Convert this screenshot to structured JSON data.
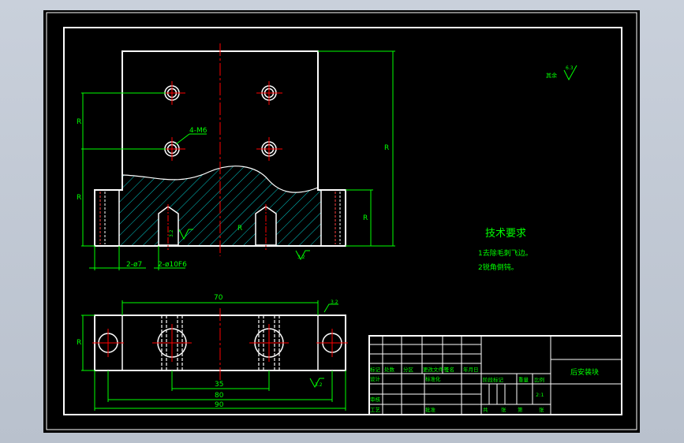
{
  "colors": {
    "background": "#000000",
    "outline": "#ffffff",
    "dimension": "#00ff00",
    "centerline": "#ff0000",
    "hatch": "#00c8c8",
    "annotation": "#00ff00"
  },
  "dims": {
    "a1": "R",
    "a2": "R",
    "a3": "R",
    "a4": "R",
    "a5": "R",
    "a6": "R",
    "thread": "4-M6",
    "hole7": "2-ø7",
    "fit": "2-ø10F6",
    "d70": "70",
    "d35": "35",
    "d80": "80",
    "d90": "90"
  },
  "surface": {
    "roughness_label": "其余",
    "rough1": "6.3",
    "rough2": "3.2",
    "rough3": "3.2",
    "rough4": "3.2"
  },
  "tech": {
    "title": "技术要求",
    "line1": "1去除毛刺飞边。",
    "line2": "2锐角倒钝。"
  },
  "titleblock": {
    "part_name": "后安装块",
    "marker": "标记",
    "count": "处数",
    "zone": "分区",
    "change_doc": "更改文件号",
    "sign": "签名",
    "date": "年月日",
    "design": "设计",
    "standard": "标准化",
    "stage": "阶段标记",
    "weight": "重量",
    "scale": "比例",
    "scale_val": "2:1",
    "review": "审核",
    "craft": "工艺",
    "approve": "批准",
    "total": "共",
    "sheet": "张",
    "of": "第",
    "sheet2": "张"
  }
}
